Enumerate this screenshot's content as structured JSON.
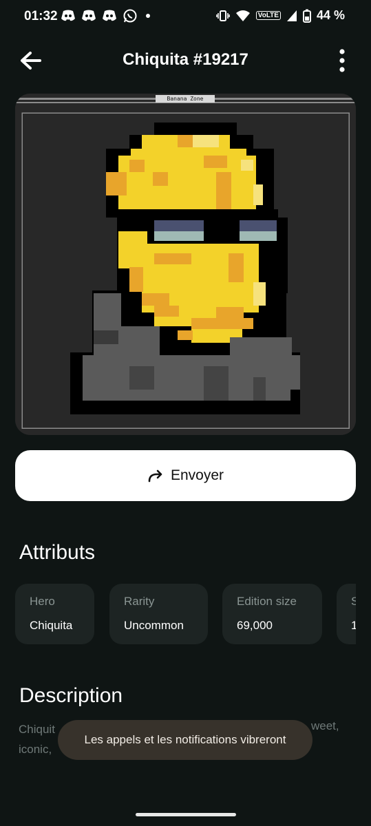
{
  "status_bar": {
    "time": "01:32",
    "battery": "44 %",
    "left_icons": [
      "discord-icon",
      "discord-icon",
      "discord-icon",
      "whatsapp-icon",
      "dot-icon"
    ],
    "right_icons": [
      "vibrate-icon",
      "wifi-icon",
      "volte-icon",
      "signal-icon",
      "battery-icon"
    ],
    "volte_text": "VoLTE"
  },
  "app_bar": {
    "title": "Chiquita #19217",
    "back_icon": "arrow-left-icon",
    "menu_icon": "more-vertical-icon"
  },
  "nft": {
    "banner": "Banana Zone",
    "colors": {
      "background": "#282828",
      "yellow": "#f3d22a",
      "orange": "#e8a52b",
      "grey": "#5a5a5a"
    }
  },
  "send": {
    "label": "Envoyer",
    "icon": "share-arrow-icon"
  },
  "attributes": {
    "title": "Attributs",
    "items": [
      {
        "label": "Hero",
        "value": "Chiquita"
      },
      {
        "label": "Rarity",
        "value": "Uncommon"
      },
      {
        "label": "Edition size",
        "value": "69,000"
      },
      {
        "label": "S",
        "value": "1"
      }
    ]
  },
  "description": {
    "title": "Description",
    "line1_start": "Chiquit",
    "line1_end": "weet,",
    "line2_start": "iconic,"
  },
  "toast": {
    "text": "Les appels et les notifications vibreront"
  },
  "colors": {
    "background": "#0f1514",
    "card": "#1d2423",
    "muted": "#8a9593",
    "toast": "#37322b"
  }
}
